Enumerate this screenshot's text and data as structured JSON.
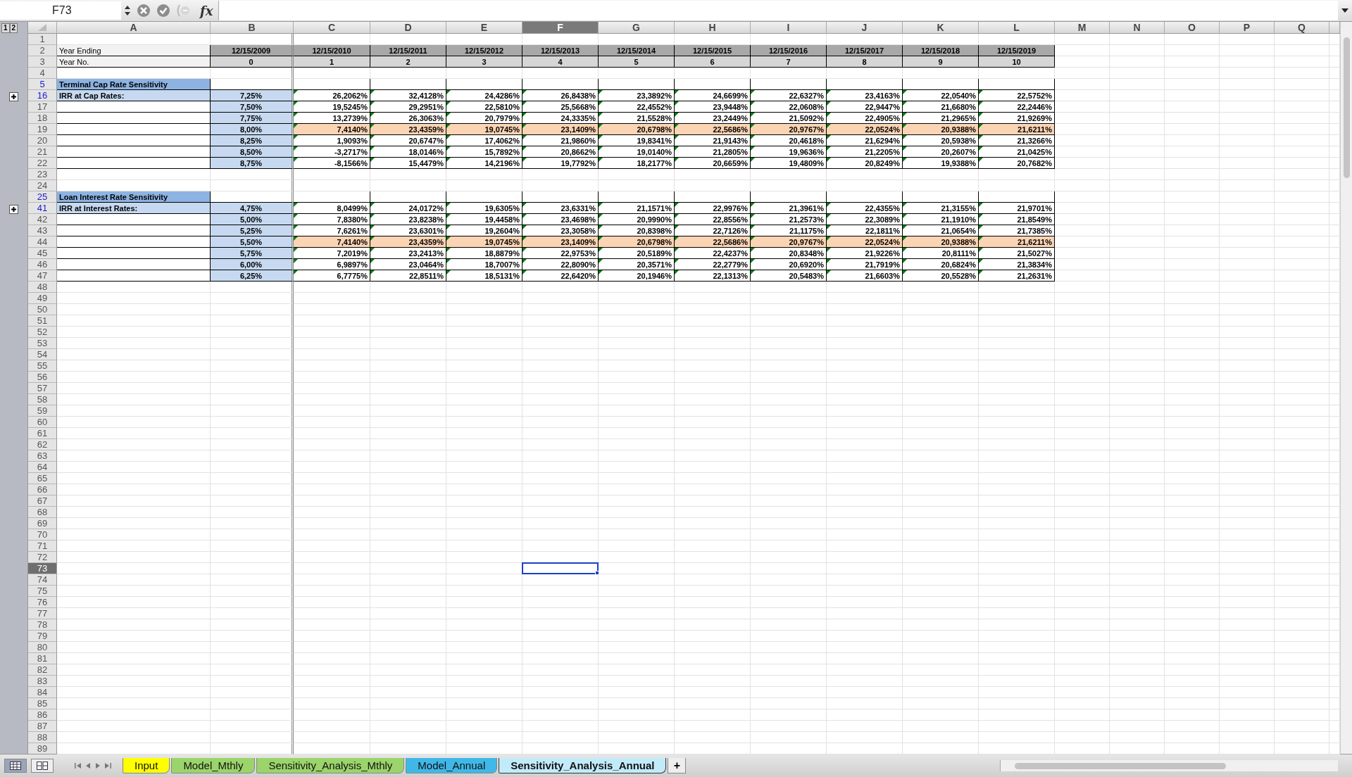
{
  "name_box": "F73",
  "formula_bar": {
    "fx": "fx"
  },
  "outline_levels": [
    "1",
    "2"
  ],
  "columns": [
    {
      "label": "A",
      "selected": false
    },
    {
      "label": "B",
      "selected": false
    },
    {
      "label": "C",
      "selected": false
    },
    {
      "label": "D",
      "selected": false
    },
    {
      "label": "E",
      "selected": false
    },
    {
      "label": "F",
      "selected": true
    },
    {
      "label": "G",
      "selected": false
    },
    {
      "label": "H",
      "selected": false
    },
    {
      "label": "I",
      "selected": false
    },
    {
      "label": "J",
      "selected": false
    },
    {
      "label": "K",
      "selected": false
    },
    {
      "label": "L",
      "selected": false
    },
    {
      "label": "M",
      "selected": false
    },
    {
      "label": "N",
      "selected": false
    },
    {
      "label": "O",
      "selected": false
    },
    {
      "label": "P",
      "selected": false
    },
    {
      "label": "Q",
      "selected": false
    }
  ],
  "rows": [
    {
      "number": "1",
      "kind": "blank",
      "selected": false
    },
    {
      "number": "2",
      "kind": "dates",
      "selected": false,
      "label": "Year Ending",
      "values": [
        "12/15/2009",
        "12/15/2010",
        "12/15/2011",
        "12/15/2012",
        "12/15/2013",
        "12/15/2014",
        "12/15/2015",
        "12/15/2016",
        "12/15/2017",
        "12/15/2018",
        "12/15/2019"
      ]
    },
    {
      "number": "3",
      "kind": "years",
      "selected": false,
      "label": "Year No.",
      "values": [
        "0",
        "1",
        "2",
        "3",
        "4",
        "5",
        "6",
        "7",
        "8",
        "9",
        "10"
      ]
    },
    {
      "number": "4",
      "kind": "blank",
      "selected": false
    },
    {
      "number": "5",
      "kind": "section",
      "selected": false,
      "hidden_adjacent": true,
      "label": "Terminal Cap Rate Sensitivity"
    },
    {
      "number": "16",
      "kind": "data",
      "selected": false,
      "hidden_adjacent": true,
      "collapsed": true,
      "flags": true,
      "highlighted": false,
      "label": "IRR at Cap Rates:",
      "rate": "7,25%",
      "values": [
        "26,2062%",
        "32,4128%",
        "24,4286%",
        "26,8438%",
        "23,3892%",
        "24,6699%",
        "22,6327%",
        "23,4163%",
        "22,0540%",
        "22,5752%"
      ]
    },
    {
      "number": "17",
      "kind": "data",
      "selected": false,
      "flags": true,
      "highlighted": false,
      "rate": "7,50%",
      "values": [
        "19,5245%",
        "29,2951%",
        "22,5810%",
        "25,5668%",
        "22,4552%",
        "23,9448%",
        "22,0608%",
        "22,9447%",
        "21,6680%",
        "22,2446%"
      ]
    },
    {
      "number": "18",
      "kind": "data",
      "selected": false,
      "flags": true,
      "highlighted": false,
      "rate": "7,75%",
      "values": [
        "13,2739%",
        "26,3063%",
        "20,7979%",
        "24,3335%",
        "21,5528%",
        "23,2449%",
        "21,5092%",
        "22,4905%",
        "21,2965%",
        "21,9269%"
      ]
    },
    {
      "number": "19",
      "kind": "data",
      "selected": false,
      "flags": true,
      "highlighted": true,
      "rate": "8,00%",
      "values": [
        "7,4140%",
        "23,4359%",
        "19,0745%",
        "23,1409%",
        "20,6798%",
        "22,5686%",
        "20,9767%",
        "22,0524%",
        "20,9388%",
        "21,6211%"
      ]
    },
    {
      "number": "20",
      "kind": "data",
      "selected": false,
      "flags": true,
      "highlighted": false,
      "rate": "8,25%",
      "values": [
        "1,9093%",
        "20,6747%",
        "17,4062%",
        "21,9860%",
        "19,8341%",
        "21,9143%",
        "20,4618%",
        "21,6294%",
        "20,5938%",
        "21,3266%"
      ]
    },
    {
      "number": "21",
      "kind": "data",
      "selected": false,
      "flags": true,
      "highlighted": false,
      "rate": "8,50%",
      "values": [
        "-3,2717%",
        "18,0146%",
        "15,7892%",
        "20,8662%",
        "19,0140%",
        "21,2805%",
        "19,9636%",
        "21,2205%",
        "20,2607%",
        "21,0425%"
      ]
    },
    {
      "number": "22",
      "kind": "data",
      "selected": false,
      "flags": true,
      "highlighted": false,
      "rate": "8,75%",
      "values": [
        "-8,1566%",
        "15,4479%",
        "14,2196%",
        "19,7792%",
        "18,2177%",
        "20,6659%",
        "19,4809%",
        "20,8249%",
        "19,9388%",
        "20,7682%"
      ]
    },
    {
      "number": "23",
      "kind": "blank",
      "selected": false
    },
    {
      "number": "24",
      "kind": "blank",
      "selected": false
    },
    {
      "number": "25",
      "kind": "section",
      "selected": false,
      "hidden_adjacent": true,
      "label": "Loan Interest Rate Sensitivity"
    },
    {
      "number": "41",
      "kind": "data",
      "selected": false,
      "hidden_adjacent": true,
      "collapsed": true,
      "flags": true,
      "highlighted": false,
      "label": "IRR at Interest Rates:",
      "rate": "4,75%",
      "values": [
        "8,0499%",
        "24,0172%",
        "19,6305%",
        "23,6331%",
        "21,1571%",
        "22,9976%",
        "21,3961%",
        "22,4355%",
        "21,3155%",
        "21,9701%"
      ]
    },
    {
      "number": "42",
      "kind": "data",
      "selected": false,
      "flags": true,
      "highlighted": false,
      "rate": "5,00%",
      "values": [
        "7,8380%",
        "23,8238%",
        "19,4458%",
        "23,4698%",
        "20,9990%",
        "22,8556%",
        "21,2573%",
        "22,3089%",
        "21,1910%",
        "21,8549%"
      ]
    },
    {
      "number": "43",
      "kind": "data",
      "selected": false,
      "flags": true,
      "highlighted": false,
      "rate": "5,25%",
      "values": [
        "7,6261%",
        "23,6301%",
        "19,2604%",
        "23,3058%",
        "20,8398%",
        "22,7126%",
        "21,1175%",
        "22,1811%",
        "21,0654%",
        "21,7385%"
      ]
    },
    {
      "number": "44",
      "kind": "data",
      "selected": false,
      "flags": true,
      "highlighted": true,
      "rate": "5,50%",
      "values": [
        "7,4140%",
        "23,4359%",
        "19,0745%",
        "23,1409%",
        "20,6798%",
        "22,5686%",
        "20,9767%",
        "22,0524%",
        "20,9388%",
        "21,6211%"
      ]
    },
    {
      "number": "45",
      "kind": "data",
      "selected": false,
      "flags": true,
      "highlighted": false,
      "rate": "5,75%",
      "values": [
        "7,2019%",
        "23,2413%",
        "18,8879%",
        "22,9753%",
        "20,5189%",
        "22,4237%",
        "20,8348%",
        "21,9226%",
        "20,8111%",
        "21,5027%"
      ]
    },
    {
      "number": "46",
      "kind": "data",
      "selected": false,
      "flags": true,
      "highlighted": false,
      "rate": "6,00%",
      "values": [
        "6,9897%",
        "23,0464%",
        "18,7007%",
        "22,8090%",
        "20,3571%",
        "22,2779%",
        "20,6920%",
        "21,7919%",
        "20,6824%",
        "21,3834%"
      ]
    },
    {
      "number": "47",
      "kind": "data",
      "selected": false,
      "flags": true,
      "highlighted": false,
      "rate": "6,25%",
      "values": [
        "6,7775%",
        "22,8511%",
        "18,5131%",
        "22,6420%",
        "20,1946%",
        "22,1313%",
        "20,5483%",
        "21,6603%",
        "20,5528%",
        "21,2631%"
      ]
    },
    {
      "number": "48",
      "kind": "blank",
      "selected": false
    },
    {
      "number": "49",
      "kind": "blank",
      "selected": false
    },
    {
      "number": "50",
      "kind": "blank",
      "selected": false
    },
    {
      "number": "51",
      "kind": "blank",
      "selected": false
    },
    {
      "number": "52",
      "kind": "blank",
      "selected": false
    },
    {
      "number": "53",
      "kind": "blank",
      "selected": false
    },
    {
      "number": "54",
      "kind": "blank",
      "selected": false
    },
    {
      "number": "55",
      "kind": "blank",
      "selected": false
    },
    {
      "number": "56",
      "kind": "blank",
      "selected": false
    },
    {
      "number": "57",
      "kind": "blank",
      "selected": false
    },
    {
      "number": "58",
      "kind": "blank",
      "selected": false
    },
    {
      "number": "59",
      "kind": "blank",
      "selected": false
    },
    {
      "number": "60",
      "kind": "blank",
      "selected": false
    },
    {
      "number": "61",
      "kind": "blank",
      "selected": false
    },
    {
      "number": "62",
      "kind": "blank",
      "selected": false
    },
    {
      "number": "63",
      "kind": "blank",
      "selected": false
    },
    {
      "number": "64",
      "kind": "blank",
      "selected": false
    },
    {
      "number": "65",
      "kind": "blank",
      "selected": false
    },
    {
      "number": "66",
      "kind": "blank",
      "selected": false
    },
    {
      "number": "67",
      "kind": "blank",
      "selected": false
    },
    {
      "number": "68",
      "kind": "blank",
      "selected": false
    },
    {
      "number": "69",
      "kind": "blank",
      "selected": false
    },
    {
      "number": "70",
      "kind": "blank",
      "selected": false
    },
    {
      "number": "71",
      "kind": "blank",
      "selected": false
    },
    {
      "number": "72",
      "kind": "blank",
      "selected": false
    },
    {
      "number": "73",
      "kind": "blank",
      "selected": true
    },
    {
      "number": "74",
      "kind": "blank",
      "selected": false
    },
    {
      "number": "75",
      "kind": "blank",
      "selected": false
    },
    {
      "number": "76",
      "kind": "blank",
      "selected": false
    },
    {
      "number": "77",
      "kind": "blank",
      "selected": false
    },
    {
      "number": "78",
      "kind": "blank",
      "selected": false
    },
    {
      "number": "79",
      "kind": "blank",
      "selected": false
    },
    {
      "number": "80",
      "kind": "blank",
      "selected": false
    },
    {
      "number": "81",
      "kind": "blank",
      "selected": false
    },
    {
      "number": "82",
      "kind": "blank",
      "selected": false
    },
    {
      "number": "83",
      "kind": "blank",
      "selected": false
    },
    {
      "number": "84",
      "kind": "blank",
      "selected": false
    },
    {
      "number": "85",
      "kind": "blank",
      "selected": false
    },
    {
      "number": "86",
      "kind": "blank",
      "selected": false
    },
    {
      "number": "87",
      "kind": "blank",
      "selected": false
    },
    {
      "number": "88",
      "kind": "blank",
      "selected": false
    },
    {
      "number": "89",
      "kind": "blank",
      "selected": false
    }
  ],
  "sheet_tabs": [
    {
      "label": "Input",
      "color": "#ffff00",
      "selected": false
    },
    {
      "label": "Model_Mthly",
      "color": "#9bd46a",
      "selected": false
    },
    {
      "label": "Sensitivity_Analysis_Mthly",
      "color": "#9bd46a",
      "selected": false
    },
    {
      "label": "Model_Annual",
      "color": "#3fb8e8",
      "selected": false
    },
    {
      "label": "Sensitivity_Analysis_Annual",
      "color": "#c2ebfa",
      "selected": true
    }
  ],
  "add_sheet": "+"
}
